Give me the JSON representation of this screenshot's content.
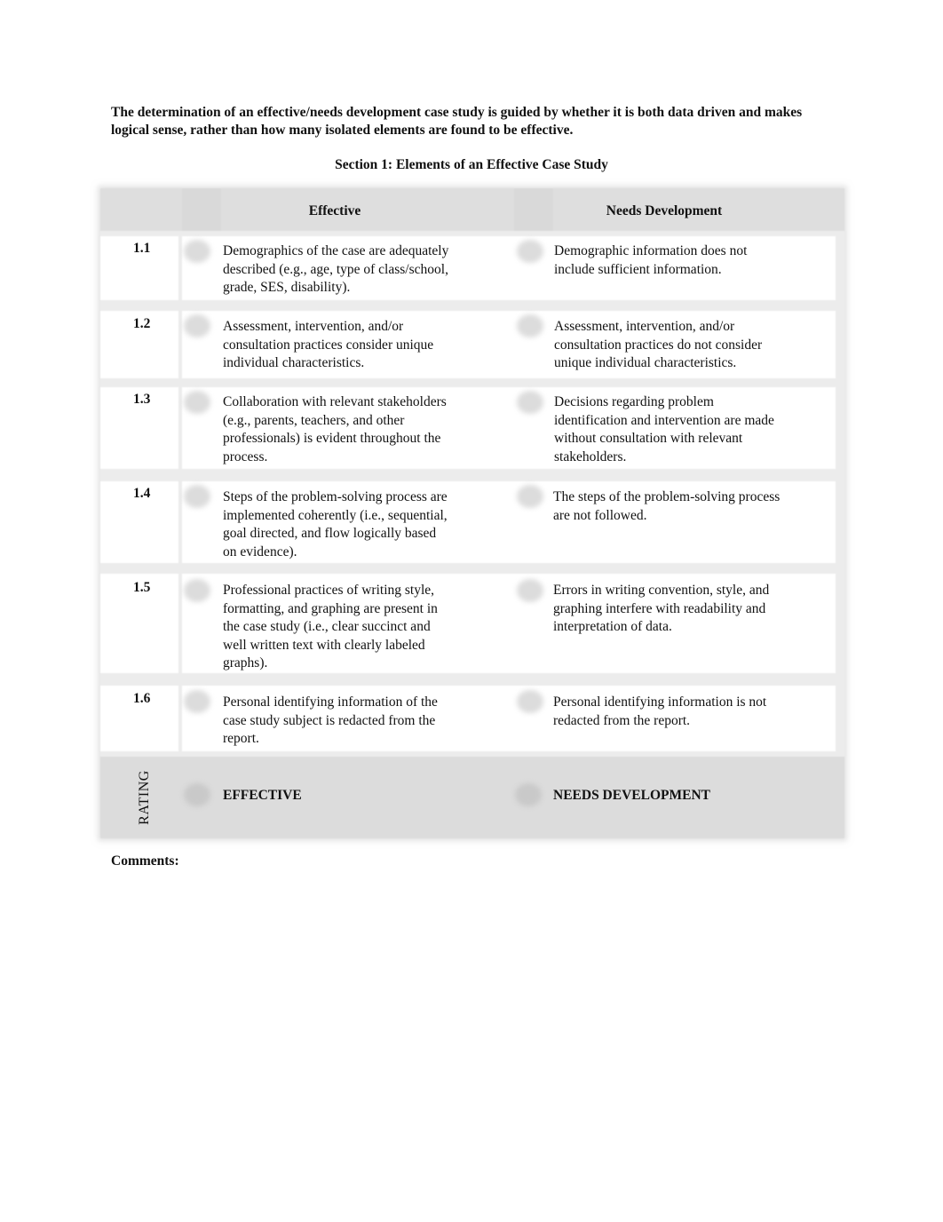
{
  "intro_text": "The determination of an effective/needs development case study is guided by whether it is both data driven and makes logical sense, rather than how many isolated elements are found to be effective.",
  "section_title": "Section 1: Elements of an Effective Case Study",
  "table": {
    "headers": {
      "number": "",
      "effective": "Effective",
      "needs_development": "Needs Development"
    },
    "rows": [
      {
        "number": "1.1",
        "effective": "Demographics of the case are adequately\ndescribed (e.g., age, type of class/school,\ngrade, SES, disability).",
        "needs_development": "Demographic information does not\n include sufficient information."
      },
      {
        "number": "1.2",
        "effective": "Assessment, intervention, and/or\nconsultation practices consider unique\nindividual characteristics.",
        "needs_development": "Assessment, intervention, and/or\n consultation practices do not consider\n unique individual characteristics."
      },
      {
        "number": "1.3",
        "effective": "Collaboration with relevant stakeholders\n(e.g., parents, teachers, and other\nprofessionals) is evident throughout the\nprocess.",
        "needs_development": "Decisions regarding problem\n identification and intervention are made\n without consultation with relevant\n stakeholders."
      },
      {
        "number": "1.4",
        "effective": "Steps of the problem-solving process are\nimplemented coherently (i.e., sequential,\ngoal directed, and flow logically based\non evidence).",
        "needs_development": "The steps of the problem-solving process\n are not followed."
      },
      {
        "number": "1.5",
        "effective": "Professional practices of writing style,\nformatting, and graphing are present in\nthe case study (i.e., clear succinct and\nwell written text with clearly labeled\ngraphs).",
        "needs_development": "Errors in writing convention, style, and\n graphing interfere with readability and\n interpretation of data."
      },
      {
        "number": "1.6",
        "effective": "Personal identifying information of the\n  case study subject is redacted from the\n  report.",
        "needs_development": "Personal identifying information is not\n redacted from the report."
      }
    ],
    "rating": {
      "label": "RATING",
      "effective": "EFFECTIVE",
      "needs_development": "NEEDS DEVELOPMENT"
    }
  },
  "comments_label": "Comments:"
}
